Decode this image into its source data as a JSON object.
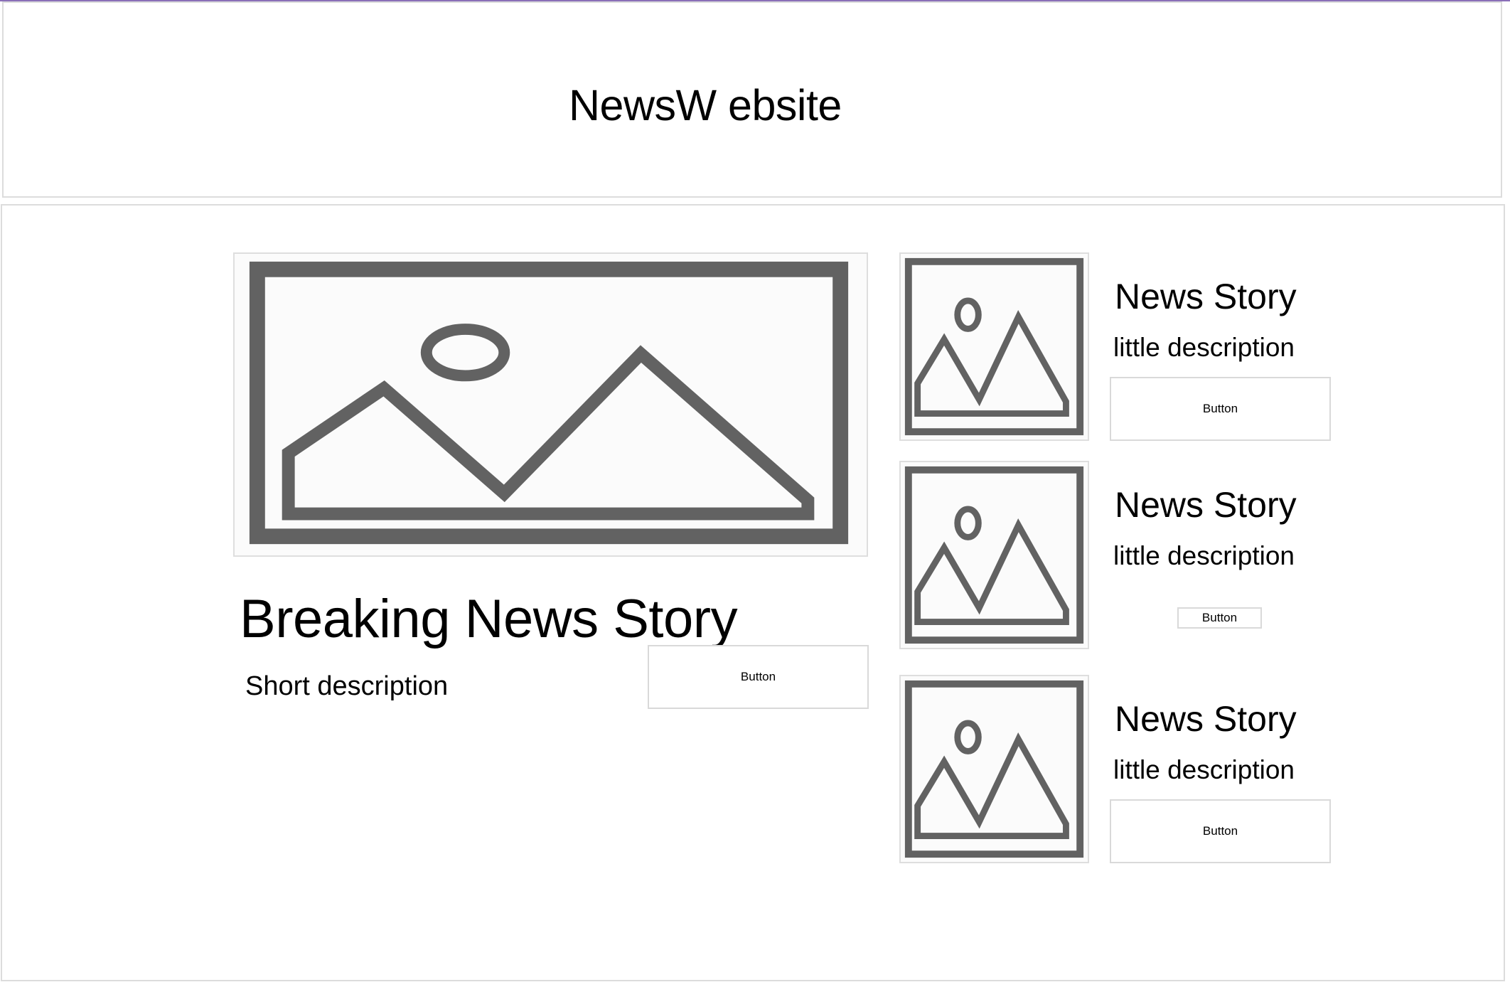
{
  "header": {
    "title": "NewsW ebsite"
  },
  "featured": {
    "image_icon": "image-placeholder-icon",
    "title": "Breaking News Story",
    "description": "Short description",
    "button_label": "Button"
  },
  "stories": [
    {
      "image_icon": "image-placeholder-icon",
      "title": "News Story",
      "description": "little description",
      "button_label": "Button"
    },
    {
      "image_icon": "image-placeholder-icon",
      "title": "News Story",
      "description": "little description",
      "button_label": "Button"
    },
    {
      "image_icon": "image-placeholder-icon",
      "title": "News Story",
      "description": "little description",
      "button_label": "Button"
    }
  ],
  "colors": {
    "accent": "#8a6fb8",
    "placeholder_stroke": "#626262",
    "border": "#dcdcdc"
  }
}
